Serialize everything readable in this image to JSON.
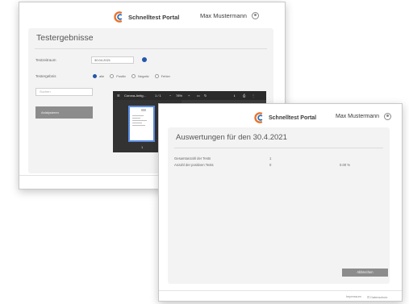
{
  "back_window": {
    "logo_text": "Schnelltest Portal",
    "user_name": "Max Mustermann",
    "page_title": "Testergebnisse",
    "form": {
      "date_label": "Testzeitraum",
      "date_value": "30.04.2021",
      "result_label": "Testergebnis",
      "radio_options": [
        {
          "label": "alle",
          "selected": true
        },
        {
          "label": "Positiv",
          "selected": false
        },
        {
          "label": "Negativ",
          "selected": false
        },
        {
          "label": "Fehler",
          "selected": false
        }
      ],
      "search_placeholder": "Suchen",
      "analyze_button": "Anlalysieren"
    },
    "pdf_viewer": {
      "file_name": "Corona-Antig...",
      "page_indicator": "1 / 1",
      "zoom": "78%",
      "thumbnail_page": "1"
    }
  },
  "front_window": {
    "logo_text": "Schnelltest Portal",
    "user_name": "Max Mustermann",
    "title": "Auswertungen für den 30.4.2021",
    "stats": [
      {
        "label": "Gesamtanzahl der Tests",
        "count": "1",
        "percent": ""
      },
      {
        "label": "Anzahl der positiven Tests",
        "count": "0",
        "percent": "0.00 %"
      }
    ],
    "cancel_button": "Abbrechen",
    "footer": {
      "imprint": "Impressum",
      "privacy": "Datenschutz"
    }
  },
  "colors": {
    "accent": "#2356a8",
    "logo_orange": "#e8732c",
    "logo_blue": "#2a6fc0",
    "button_gray": "#8c8c8c",
    "card_bg": "#f3f3f3"
  }
}
